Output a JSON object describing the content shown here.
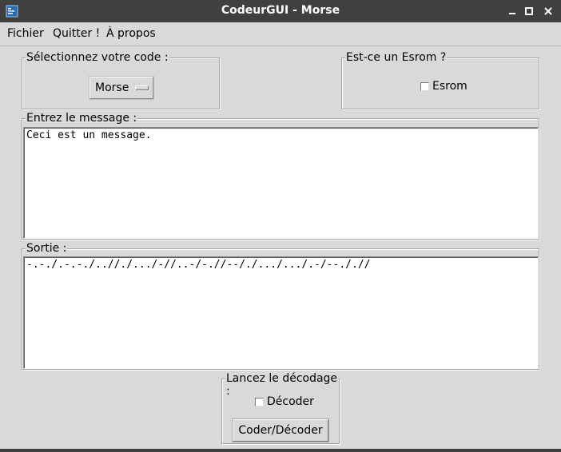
{
  "window": {
    "title": "CodeurGUI - Morse",
    "colors": {
      "titlebar": "#404040",
      "background": "#d9d9d9"
    }
  },
  "menu": {
    "items": [
      "Fichier",
      "Quitter !",
      "À propos"
    ]
  },
  "code_group": {
    "label": "Sélectionnez votre code :",
    "selected": "Morse"
  },
  "esrom_group": {
    "label": "Est-ce un Esrom ?",
    "checkbox_label": "Esrom",
    "checked": false
  },
  "message_group": {
    "label": "Entrez le message :",
    "text": "Ceci est un message."
  },
  "output_group": {
    "label": "Sortie :",
    "text": "-.-./.-.-./..//./.../-//..-/-.//--/./.../.../.-/--././/"
  },
  "decode_group": {
    "label": "Lancez le décodage :",
    "checkbox_label": "Décoder",
    "checked": false,
    "button_label": "Coder/Décoder"
  },
  "icons": [
    "app-icon",
    "minimize-icon",
    "maximize-icon",
    "close-icon"
  ]
}
